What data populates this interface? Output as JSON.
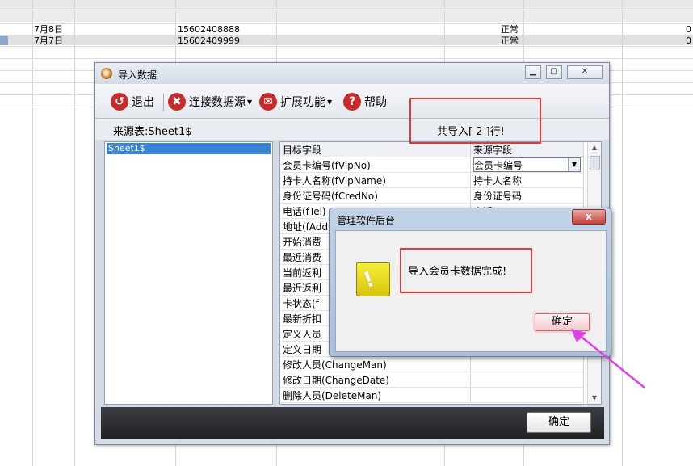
{
  "spreadsheet": {
    "rows": [
      {
        "date": "7月8日",
        "phone": "15602408888",
        "status": "正常",
        "balance": "0"
      },
      {
        "date": "7月7日",
        "phone": "15602409999",
        "status": "正常",
        "balance": "0"
      }
    ]
  },
  "dialog": {
    "title": "导入数据",
    "toolbar": {
      "exit_label": "退出",
      "connect_label": "连接数据源",
      "extend_label": "扩展功能",
      "help_label": "帮助"
    },
    "source_label": "来源表:Sheet1$",
    "import_count": "共导入[ 2 ]行!",
    "sheet_list": [
      "Sheet1$"
    ],
    "grid": {
      "headers": [
        "目标字段",
        "来源字段"
      ],
      "rows": [
        {
          "target": "会员卡编号(fVipNo)",
          "source": "会员卡编号"
        },
        {
          "target": "持卡人名称(fVipName)",
          "source": "持卡人名称"
        },
        {
          "target": "身份证号码(fCredNo)",
          "source": "身份证号码"
        },
        {
          "target": "电话(fTel)",
          "source": "电话"
        },
        {
          "target": "地址(fAddress)",
          "source": ""
        },
        {
          "target": "开始消费",
          "source": ""
        },
        {
          "target": "最近消费",
          "source": ""
        },
        {
          "target": "当前返利",
          "source": ""
        },
        {
          "target": "最近返利",
          "source": ""
        },
        {
          "target": "卡状态(f",
          "source": ""
        },
        {
          "target": "最新折扣",
          "source": ""
        },
        {
          "target": "定义人员",
          "source": ""
        },
        {
          "target": "定义日期",
          "source": ""
        },
        {
          "target": "修改人员(ChangeMan)",
          "source": ""
        },
        {
          "target": "修改日期(ChangeDate)",
          "source": ""
        },
        {
          "target": "删除人员(DeleteMan)",
          "source": ""
        }
      ]
    },
    "ok_label": "确定"
  },
  "message_box": {
    "title": "管理软件后台",
    "close_label": "x",
    "message": "导入会员卡数据完成!",
    "ok_label": "确定"
  },
  "colors": {
    "highlight_red": "#e03a3a",
    "annotation_arrow": "#e040e8",
    "selection_blue": "#3a84d6"
  }
}
